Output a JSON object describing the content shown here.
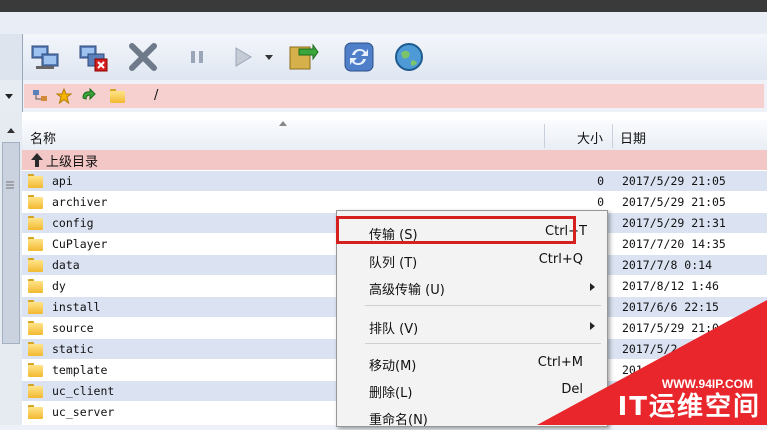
{
  "columns": {
    "name": "名称",
    "size": "大小",
    "date": "日期"
  },
  "address": {
    "path": "/"
  },
  "parent_row": {
    "label": "上级目录"
  },
  "files": [
    {
      "name": "api",
      "size": "0",
      "date": "2017/5/29 21:05"
    },
    {
      "name": "archiver",
      "size": "0",
      "date": "2017/5/29 21:05"
    },
    {
      "name": "config",
      "size": "",
      "date": "2017/5/29 21:31"
    },
    {
      "name": "CuPlayer",
      "size": "",
      "date": "2017/7/20 14:35"
    },
    {
      "name": "data",
      "size": "",
      "date": "2017/7/8 0:14"
    },
    {
      "name": "dy",
      "size": "",
      "date": "2017/8/12 1:46"
    },
    {
      "name": "install",
      "size": "",
      "date": "2017/6/6 22:15"
    },
    {
      "name": "source",
      "size": "",
      "date": "2017/5/29 21:0"
    },
    {
      "name": "static",
      "size": "",
      "date": "2017/5/2"
    },
    {
      "name": "template",
      "size": "",
      "date": "201"
    },
    {
      "name": "uc_client",
      "size": "",
      "date": ""
    },
    {
      "name": "uc_server",
      "size": "",
      "date": ""
    }
  ],
  "context_menu": {
    "transfer": {
      "label": "传输 (S)",
      "shortcut": "Ctrl+T"
    },
    "queue": {
      "label": "队列 (T)",
      "shortcut": "Ctrl+Q"
    },
    "advanced": {
      "label": "高级传输 (U)"
    },
    "sort": {
      "label": "排队 (V)"
    },
    "move": {
      "label": "移动(M)",
      "shortcut": "Ctrl+M"
    },
    "delete": {
      "label": "删除(L)",
      "shortcut": "Del"
    },
    "rename": {
      "label": "重命名(N)"
    }
  },
  "watermark": {
    "url": "WWW.94IP.COM",
    "brand": "IT运维空间"
  },
  "colors": {
    "highlight": "#d61f1f",
    "parent_row": "#f4c7c7",
    "address_bar": "#f6cfcf",
    "alt_row": "#dbe3f3"
  },
  "toolbar_icons": [
    "connect-icon",
    "disconnect-icon",
    "stop-icon",
    "pause-icon",
    "play-icon",
    "dropdown-icon",
    "transfer-icon",
    "refresh-icon",
    "globe-icon"
  ]
}
